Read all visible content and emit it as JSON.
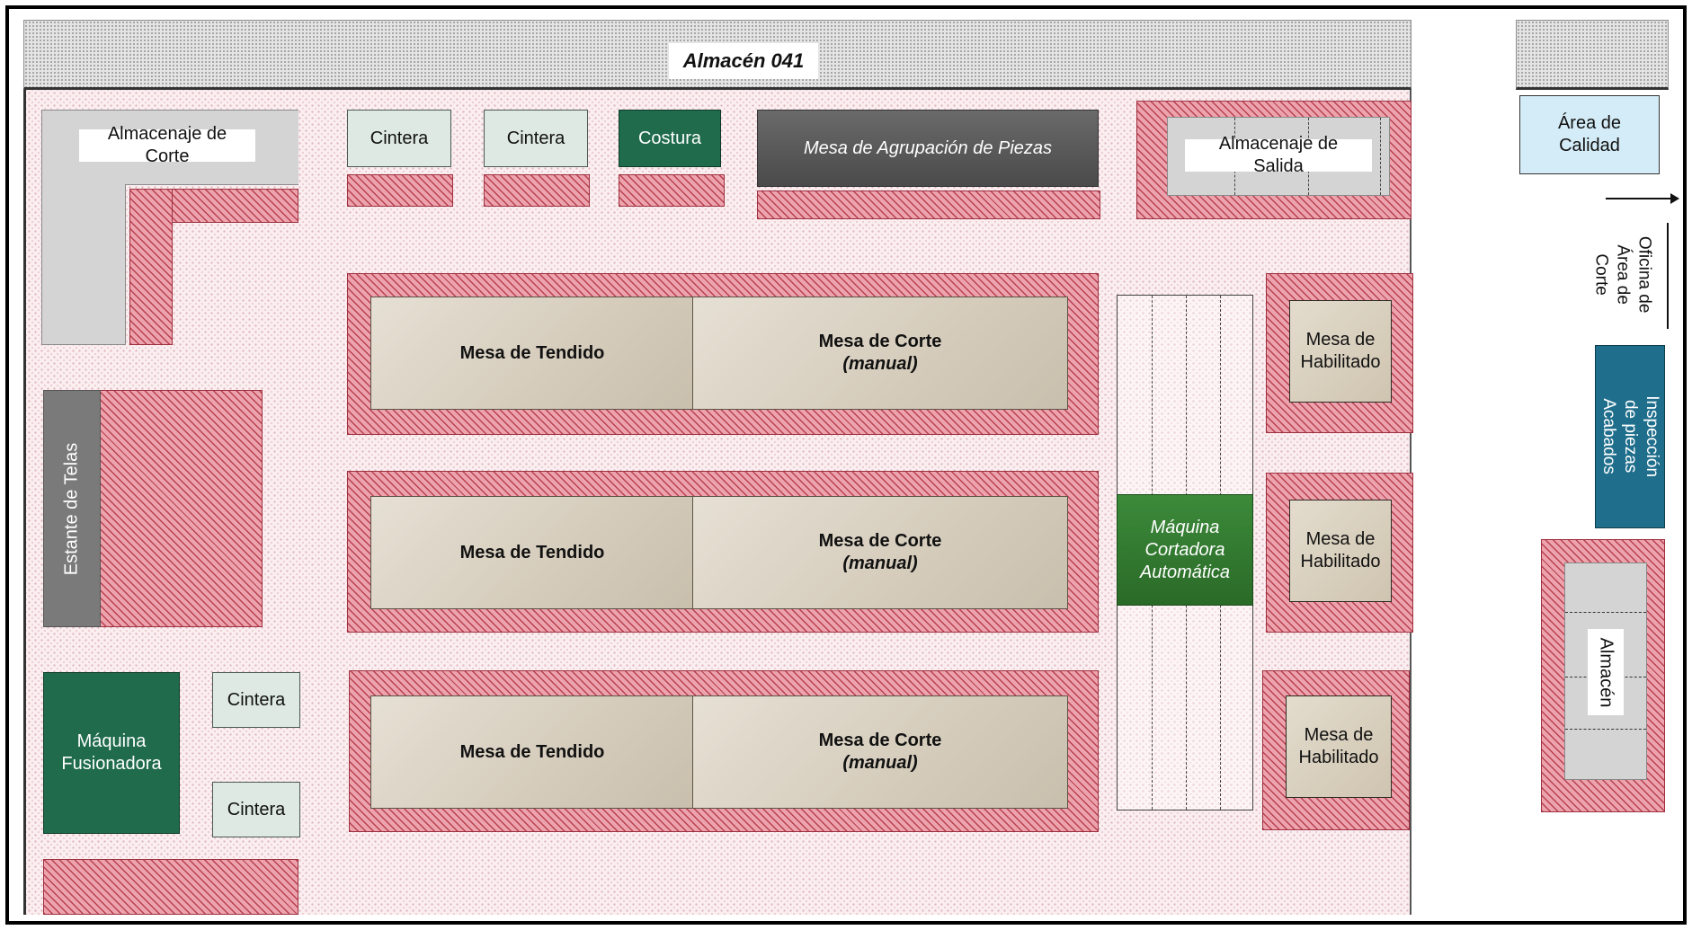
{
  "title": "Almacén 041",
  "areas": {
    "almacenaje_corte": "Almacenaje de Corte",
    "cintera_top_1": "Cintera",
    "cintera_top_2": "Cintera",
    "costura": "Costura",
    "mesa_agrupacion": "Mesa de Agrupación de Piezas",
    "almacenaje_salida": "Almacenaje de Salida",
    "estante_telas": "Estante de Telas",
    "maquina_fusionadora": "Máquina Fusionadora",
    "cintera_left_1": "Cintera",
    "cintera_left_2": "Cintera",
    "maquina_cortadora": "Máquina Cortadora Automática"
  },
  "tables": [
    {
      "tendido": "Mesa de Tendido",
      "corte": "Mesa de Corte",
      "corte_sub": "(manual)"
    },
    {
      "tendido": "Mesa de Tendido",
      "corte": "Mesa de Corte",
      "corte_sub": "(manual)"
    },
    {
      "tendido": "Mesa de Tendido",
      "corte": "Mesa de Corte",
      "corte_sub": "(manual)"
    }
  ],
  "habilitado": [
    "Mesa de Habilitado",
    "Mesa de Habilitado",
    "Mesa de Habilitado"
  ],
  "outside": {
    "area_calidad": "Área de Calidad",
    "oficina": "Oficina de Área de Corte",
    "inspeccion": "Inspección de piezas Acabados",
    "almacen": "Almacén"
  }
}
